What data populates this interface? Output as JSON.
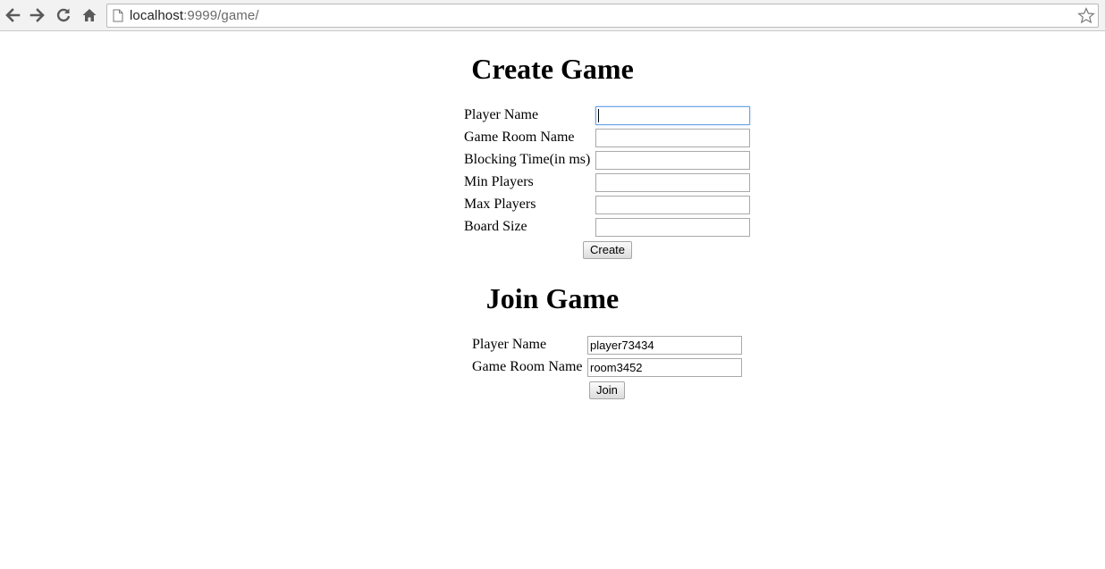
{
  "browser": {
    "url_host": "localhost",
    "url_rest": ":9999/game/"
  },
  "create_game": {
    "title": "Create Game",
    "fields": [
      {
        "label": "Player Name",
        "value": ""
      },
      {
        "label": "Game Room Name",
        "value": ""
      },
      {
        "label": "Blocking Time(in ms)",
        "value": ""
      },
      {
        "label": "Min Players",
        "value": ""
      },
      {
        "label": "Max Players",
        "value": ""
      },
      {
        "label": "Board Size",
        "value": ""
      }
    ],
    "submit_label": "Create"
  },
  "join_game": {
    "title": "Join Game",
    "fields": [
      {
        "label": "Player Name",
        "value": "player73434"
      },
      {
        "label": "Game Room Name",
        "value": "room3452"
      }
    ],
    "submit_label": "Join"
  }
}
